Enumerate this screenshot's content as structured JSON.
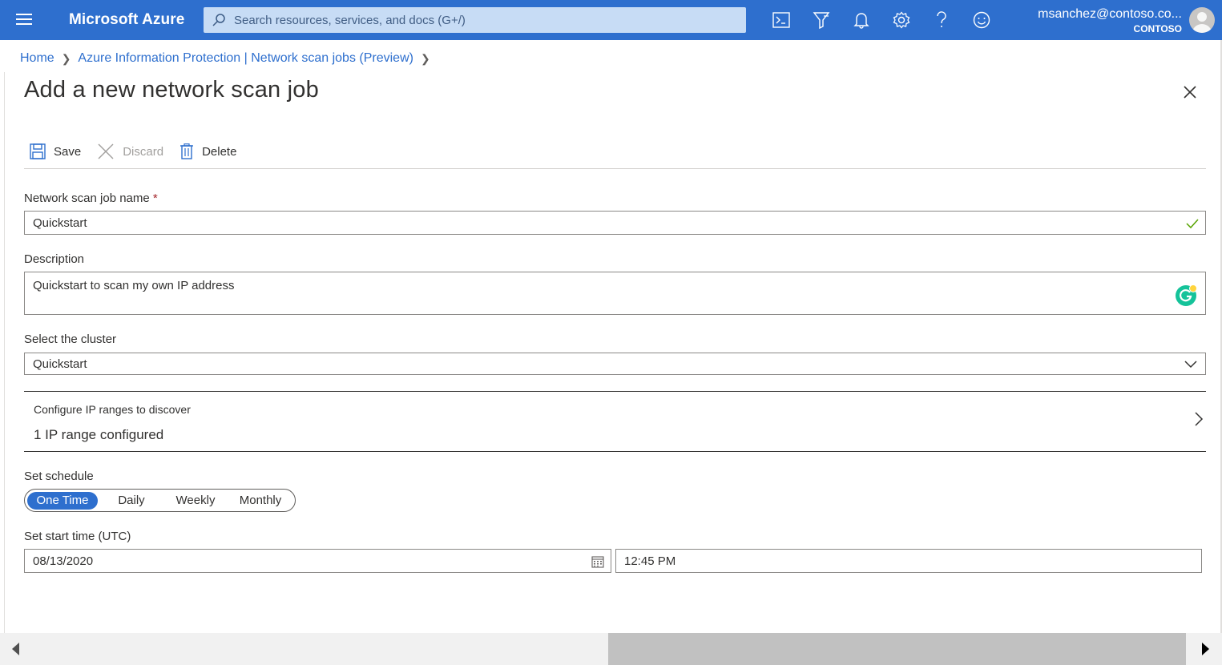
{
  "header": {
    "brand": "Microsoft Azure",
    "search_placeholder": "Search resources, services, and docs (G+/)",
    "account_email": "msanchez@contoso.co...",
    "account_tenant": "CONTOSO",
    "accent_color": "#2e6fce"
  },
  "breadcrumb": {
    "items": [
      "Home",
      "Azure Information Protection | Network scan jobs (Preview)"
    ]
  },
  "panel": {
    "title": "Add a new network scan job"
  },
  "toolbar": {
    "save_label": "Save",
    "discard_label": "Discard",
    "delete_label": "Delete"
  },
  "form": {
    "name_label": "Network scan job name",
    "required_mark": "*",
    "name_value": "Quickstart",
    "description_label": "Description",
    "description_value": "Quickstart to scan my own IP address",
    "cluster_label": "Select the cluster",
    "cluster_value": "Quickstart",
    "ip_title": "Configure IP ranges to discover",
    "ip_summary": "1 IP range configured",
    "schedule_label": "Set schedule",
    "schedule_options": [
      "One Time",
      "Daily",
      "Weekly",
      "Monthly"
    ],
    "schedule_selected": "One Time",
    "start_time_label": "Set start time (UTC)",
    "start_date": "08/13/2020",
    "start_time": "12:45 PM"
  }
}
